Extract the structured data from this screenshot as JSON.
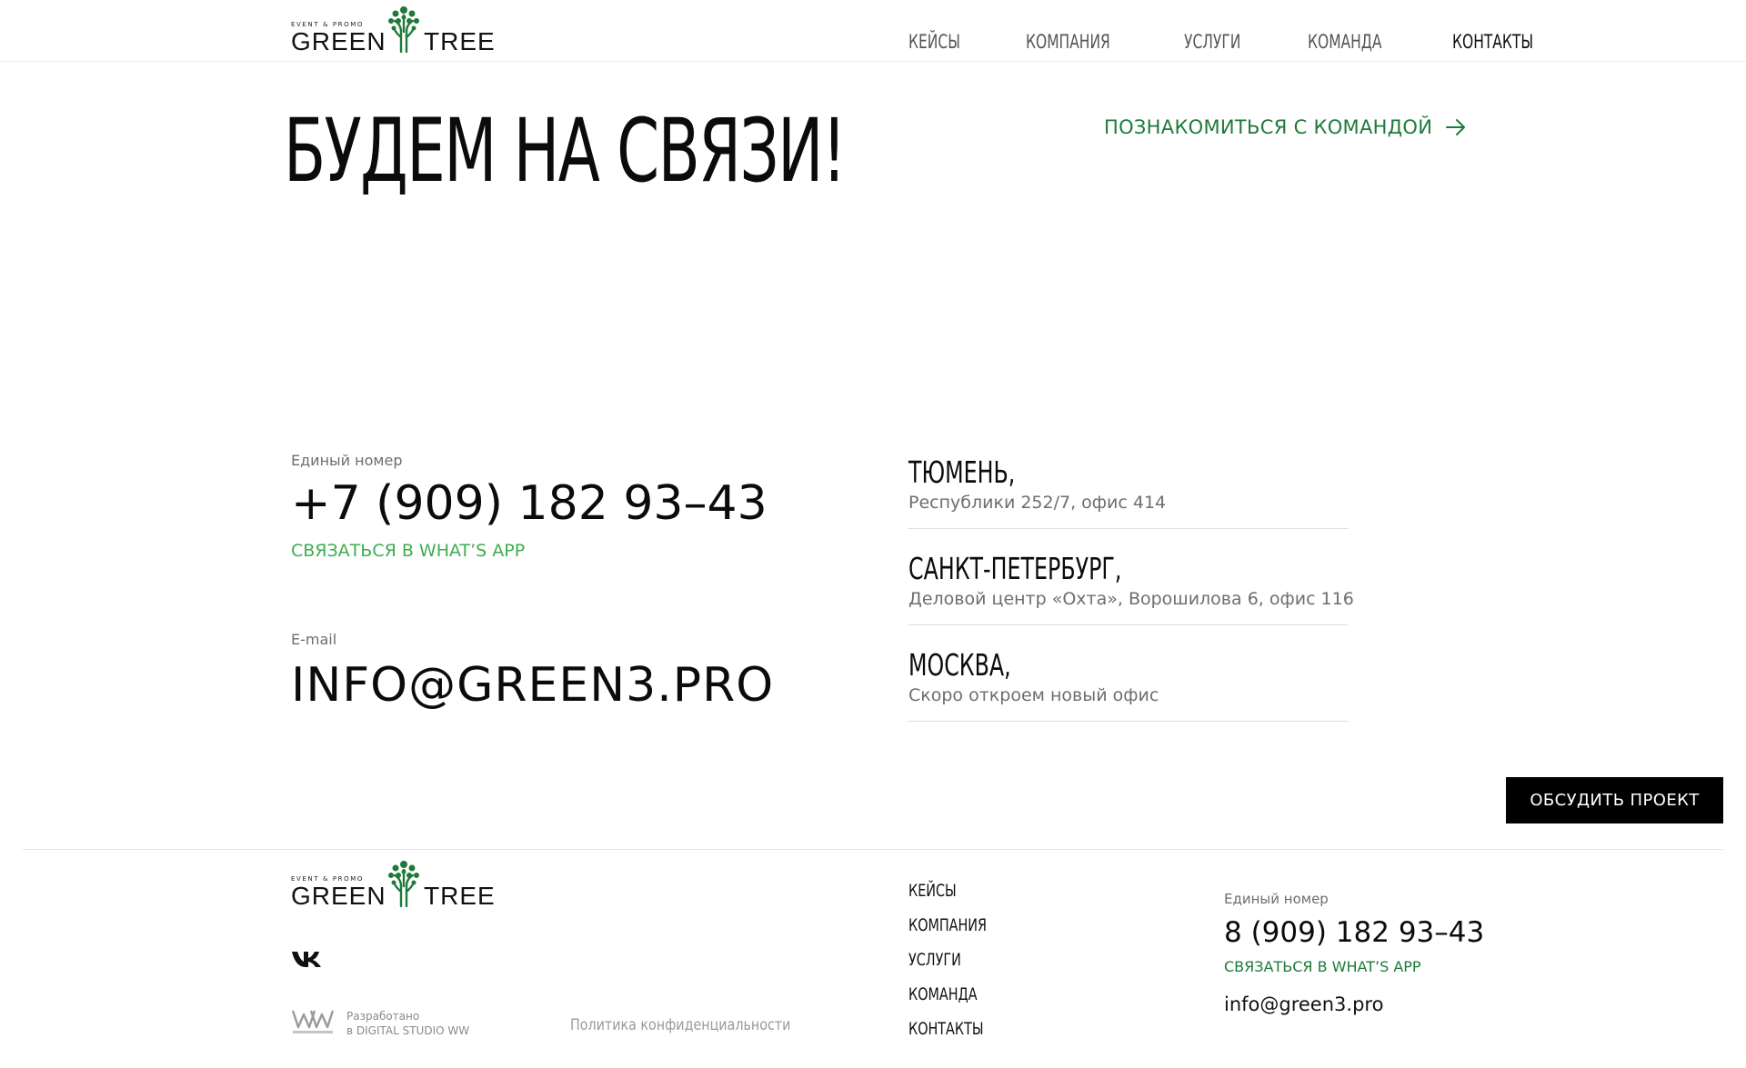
{
  "brand": {
    "tagline": "EVENT & PROMO",
    "word_left": "GREEN",
    "word_right": "TREE",
    "logo_icon": "tree-icon",
    "accent_green": "#1e7a3a",
    "whatsapp_green": "#3dae4f"
  },
  "header": {
    "nav": [
      "КЕЙСЫ",
      "КОМПАНИЯ",
      "УСЛУГИ",
      "КОМАНДА",
      "КОНТАКТЫ"
    ],
    "active": "КОНТАКТЫ"
  },
  "hero": {
    "title": "БУДЕМ НА СВЯЗИ!",
    "team_link": "ПОЗНАКОМИТЬСЯ С КОМАНДОЙ",
    "team_link_icon": "arrow-right-icon"
  },
  "contacts": {
    "phone_label": "Единый номер",
    "phone": "+7 (909) 182 93–43",
    "whatsapp": "СВЯЗАТЬСЯ В WHAT’S APP",
    "email_label": "E-mail",
    "email": "INFO@GREEN3.PRO"
  },
  "offices": [
    {
      "city": "ТЮМЕНЬ,",
      "address": "Республики 252/7, офис 414"
    },
    {
      "city": "САНКТ-ПЕТЕРБУРГ,",
      "address": "Деловой центр «Охта», Ворошилова 6, офис 116"
    },
    {
      "city": "МОСКВА,",
      "address": "Скоро откроем новый офис"
    }
  ],
  "cta": {
    "label": "ОБСУДИТЬ ПРОЕКТ"
  },
  "footer": {
    "social_icon": "vk-icon",
    "developer_logo_icon": "ww-digital-studio-logo",
    "developer_line1": "Разработано",
    "developer_line2": "в DIGITAL STUDIO WW",
    "privacy": "Политика конфиденциальности",
    "nav": [
      "КЕЙСЫ",
      "КОМПАНИЯ",
      "УСЛУГИ",
      "КОМАНДА",
      "КОНТАКТЫ"
    ],
    "phone_label": "Единый номер",
    "phone": "8 (909) 182 93–43",
    "whatsapp": "СВЯЗАТЬСЯ В WHAT’S APP",
    "email": "info@green3.pro"
  }
}
